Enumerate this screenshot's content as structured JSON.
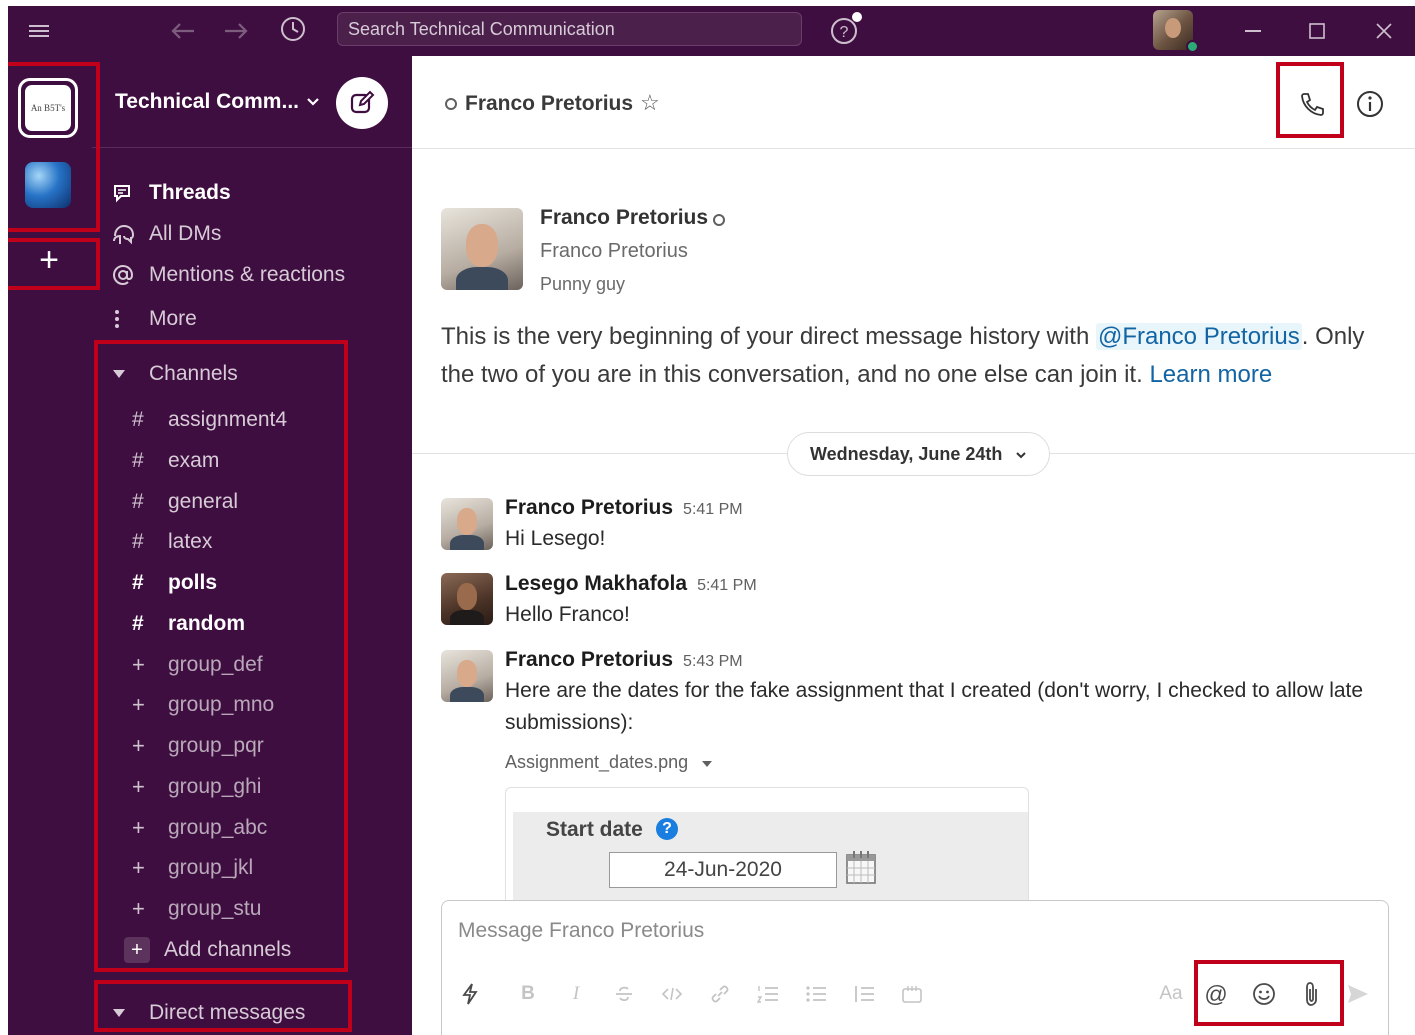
{
  "topbar": {
    "search_text": "Search Technical Communication",
    "help_icon": "help-icon",
    "history_icon": "clock-icon"
  },
  "workspaces": {
    "current_label": "An B5T's",
    "add_label": "+"
  },
  "sidebar": {
    "workspace_name": "Technical Comm...",
    "nav": [
      {
        "label": "Threads",
        "icon": "threads-icon"
      },
      {
        "label": "All DMs",
        "icon": "dms-icon"
      },
      {
        "label": "Mentions & reactions",
        "icon": "at-icon"
      },
      {
        "label": "More",
        "icon": "more-icon"
      }
    ],
    "channels_header": "Channels",
    "channels": [
      {
        "label": "assignment4",
        "icon": "#"
      },
      {
        "label": "exam",
        "icon": "#"
      },
      {
        "label": "general",
        "icon": "#"
      },
      {
        "label": "latex",
        "icon": "#"
      },
      {
        "label": "polls",
        "icon": "#"
      },
      {
        "label": "random",
        "icon": "#"
      },
      {
        "label": "group_def",
        "icon": "+"
      },
      {
        "label": "group_mno",
        "icon": "+"
      },
      {
        "label": "group_pqr",
        "icon": "+"
      },
      {
        "label": "group_ghi",
        "icon": "+"
      },
      {
        "label": "group_abc",
        "icon": "+"
      },
      {
        "label": "group_jkl",
        "icon": "+"
      },
      {
        "label": "group_stu",
        "icon": "+"
      }
    ],
    "add_channels": "Add channels",
    "dm_header": "Direct messages"
  },
  "main": {
    "header": {
      "title": "Franco Pretorius",
      "star": "☆"
    },
    "intro": {
      "name": "Franco Pretorius",
      "display_name": "Franco Pretorius",
      "title": "Punny guy",
      "text_before": "This is the very beginning of your direct message history with ",
      "mention": "@Franco Pretorius",
      "text_after": ". Only the two of you are in this conversation, and no one else can join it. ",
      "learn_more": "Learn more"
    },
    "date_divider": "Wednesday, June 24th",
    "messages": [
      {
        "author": "Franco Pretorius",
        "time": "5:41 PM",
        "text": "Hi Lesego!"
      },
      {
        "author": "Lesego Makhafola",
        "time": "5:41 PM",
        "text": "Hello Franco!"
      },
      {
        "author": "Franco Pretorius",
        "time": "5:43 PM",
        "text": "Here are the dates for the fake assignment that I created (don't worry, I checked to allow late submissions):"
      }
    ],
    "attachment": {
      "file_name": "Assignment_dates.png",
      "preview_label": "Start date",
      "preview_help": "?",
      "preview_date": "24-Jun-2020"
    },
    "composer": {
      "placeholder": "Message Franco Pretorius",
      "tools": {
        "bold": "B",
        "italic": "I",
        "format": "Aa",
        "mention": "@"
      }
    }
  },
  "colors": {
    "sidebar_bg": "#3f0e40",
    "accent_link": "#1264a3",
    "annotation": "#c0001a",
    "presence": "#2bac76"
  }
}
